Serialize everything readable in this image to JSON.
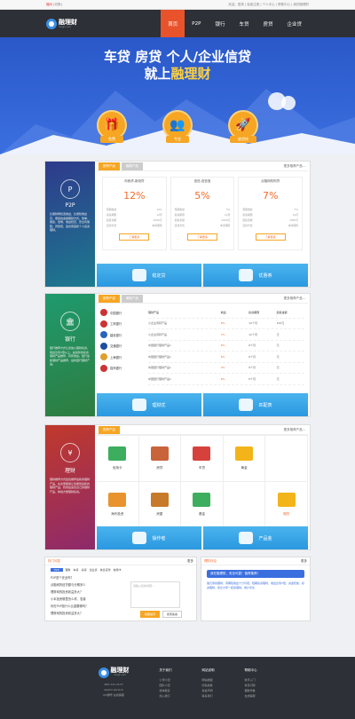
{
  "top": {
    "city": "福州",
    "switch": "[切换]",
    "links": "欢迎，登录 | 免费注册 | 个人中心 | 帮助中心 | 我的融理财"
  },
  "logo": {
    "name": "融理财",
    "sub": "ronglc.com"
  },
  "menu": [
    "首页",
    "P2P",
    "银行",
    "车贷",
    "房贷",
    "企业贷"
  ],
  "hero": {
    "line1": "车贷 房贷 个人/企业信贷",
    "line2a": "就上",
    "line2b": "融理财",
    "features": [
      {
        "label": "免费",
        "icon": "gift-icon"
      },
      {
        "label": "专业",
        "icon": "team-icon"
      },
      {
        "label": "放贷快",
        "icon": "rocket-icon"
      }
    ]
  },
  "p2p": {
    "side_title": "P2P",
    "side_desc": "比理财网优选收益，比保险收益高，便捷的金融理财方式，简单、便捷、透明、收益稳定，安全有保障，风险低，适合家庭和个人投资理财。",
    "tabs": [
      "推荐产品",
      "最新产品"
    ],
    "more": "更多推荐产品...",
    "cards": [
      {
        "name": "你我贷-新浪贷",
        "pct": "12%",
        "rows": [
          [
            "预期收益",
            "12%"
          ],
          [
            "投资期限",
            "12月"
          ],
          [
            "起投金额",
            "1000元"
          ],
          [
            "还款方式",
            "本金保障"
          ]
        ],
        "btn": "了解更多"
      },
      {
        "name": "宜信-宜信宝",
        "pct": "5%",
        "rows": [
          [
            "预期收益",
            "5%"
          ],
          [
            "投资期限",
            "12月"
          ],
          [
            "起投金额",
            "1000元"
          ],
          [
            "还款方式",
            "本金保障"
          ]
        ],
        "btn": "了解更多"
      },
      {
        "name": "点融网机构贷",
        "pct": "7%",
        "rows": [
          [
            "预期收益",
            "7%"
          ],
          [
            "投资期限",
            "12月"
          ],
          [
            "起投金额",
            "1000元"
          ],
          [
            "还款方式",
            "本金保障"
          ]
        ],
        "btn": "了解更多"
      }
    ],
    "banners": [
      "稳定贷",
      "优惠券"
    ]
  },
  "bank": {
    "side_title": "银行",
    "side_desc": "银行推荐方式让您放心理财投资，收益达到3倍以上，是最新的投资理财产品推荐，有所收益。银行最新理财产品推荐，最新银行理财产品。",
    "tabs": [
      "推荐产品",
      "最新产品"
    ],
    "more": "更多推荐产品...",
    "list": [
      "中国银行",
      "工商银行",
      "建设银行",
      "交通银行",
      "上海银行",
      "招商银行"
    ],
    "head": [
      "理财产品",
      "收益",
      "投资期限",
      "起投金额"
    ],
    "rows": [
      [
        "小企业周转产品",
        "6%",
        "12个月",
        "100元"
      ],
      [
        "小企业周转产品",
        "7%",
        "12个月",
        "元"
      ],
      [
        "中国银行理财产品1",
        "6%",
        "6个月",
        "元"
      ],
      [
        "中国银行理财产品1",
        "6%",
        "6个月",
        "元"
      ],
      [
        "中国银行理财产品1",
        "4%",
        "6个月",
        "元"
      ],
      [
        "中国银行理财产品1",
        "6%",
        "6个月",
        "元"
      ]
    ],
    "banners": [
      "理财优",
      "匹配表"
    ]
  },
  "finance": {
    "side_title": "理财",
    "side_desc": "理财推荐方式给您推荐最新的理财产品，在这里能够让您看到最新的理财产品，找到最适合自己的理财产品，体验方便理财投资。",
    "tabs": [
      "推荐产品"
    ],
    "more": "更多推荐产品...",
    "items": [
      "信用卡",
      "房贷",
      "车贷",
      "黄金",
      "",
      "海外投资",
      "房屋",
      "基金",
      "",
      "期货"
    ],
    "colors": [
      "#3cae5e",
      "#c9633a",
      "#d6423b",
      "#f2b418",
      "",
      "#e8932d",
      "#c77a2a",
      "#3cae5e",
      "",
      "#f2b418"
    ],
    "banners": [
      "操作者",
      "产品金"
    ]
  },
  "qa": {
    "title": "热门问答",
    "more": "更多",
    "tabs": [
      "P2P",
      "理财",
      "车贷",
      "房贷",
      "企业贷",
      "信息贷款",
      "信用卡"
    ],
    "items": [
      "P2P是个安全吗？",
      "点融网的信贷额与分期多少",
      "理财网的投资收益多大？",
      "小本投资哪里怎么样，靠谱",
      "你在P2P投什么比重要哪吗？",
      "理财网的投资收益多大？"
    ],
    "ask_ph": "请输入您的问题...",
    "btn1": "我要提问",
    "btn2": "搜索答案"
  },
  "review": {
    "title": "理财评论",
    "more": "更多",
    "headline": "我在融理财，安全可靠！值得推荐！",
    "text": "融元易线理财，周期短收益十分可观，短期投资理财，收益达到3倍，资金稳健，投资理财，建议大家一起来理财。用户评论"
  },
  "footer": {
    "contact": [
      "400-111-1177",
      "weixin:service",
      "QQ群号 在线客服"
    ],
    "cols": [
      {
        "h": "关于我们",
        "items": [
          "公司介绍",
          "团队介绍",
          "媒体报道",
          "加入我们"
        ]
      },
      {
        "h": "网站说明",
        "items": [
          "网站地图",
          "隐私政策",
          "免责声明",
          "联系我们"
        ]
      },
      {
        "h": "帮助中心",
        "items": [
          "新手入门",
          "常见问题",
          "理财学堂",
          "在线客服"
        ]
      }
    ]
  }
}
